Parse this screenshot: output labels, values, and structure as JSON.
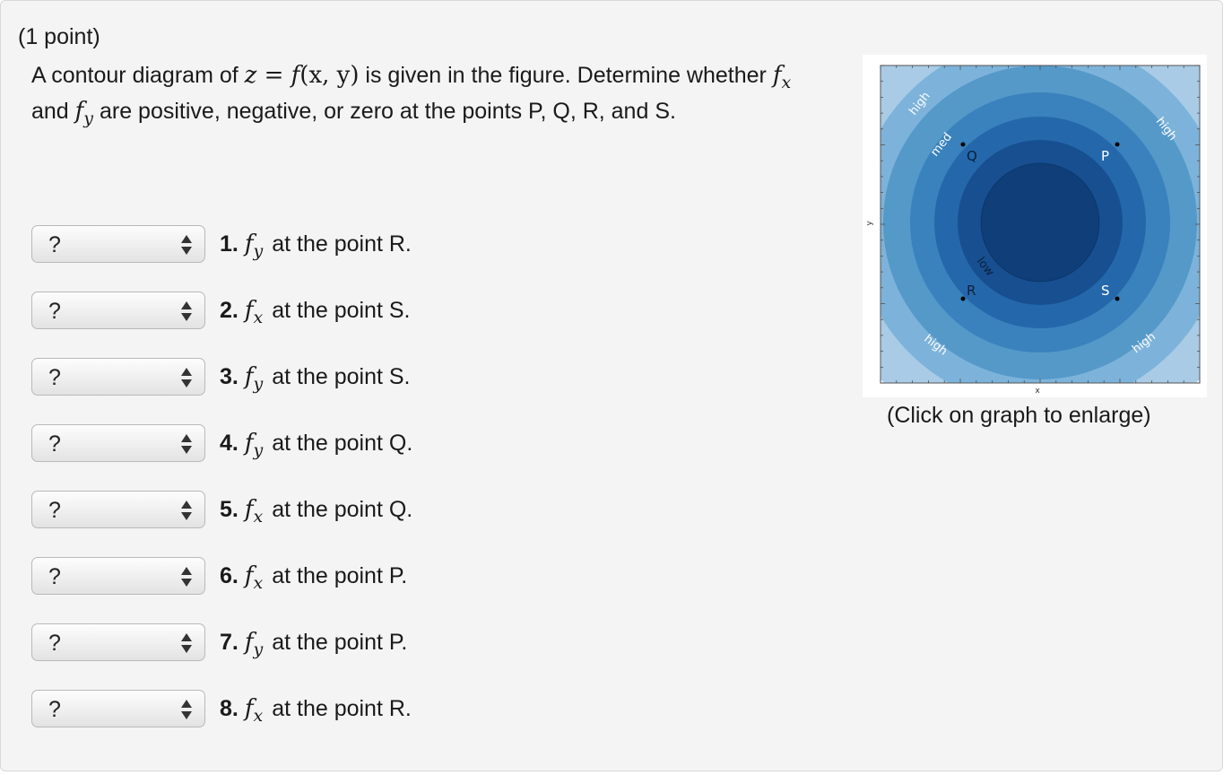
{
  "header": {
    "points": "(1 point)"
  },
  "prompt": {
    "part1": "A contour diagram of ",
    "eq_z": "z",
    "eq_eq": " = ",
    "eq_f": "f",
    "eq_args": "(x, y)",
    "part2": " is given in the figure. Determine whether ",
    "fx_f": "f",
    "fx_sub": "x",
    "part3": " and ",
    "fy_f": "f",
    "fy_sub": "y",
    "part4": " are positive, negative, or zero at the points P, Q, R, and S."
  },
  "questions": [
    {
      "select_value": "?",
      "number": "1.",
      "f": "f",
      "sub": "y",
      "text": "at the point R."
    },
    {
      "select_value": "?",
      "number": "2.",
      "f": "f",
      "sub": "x",
      "text": "at the point S."
    },
    {
      "select_value": "?",
      "number": "3.",
      "f": "f",
      "sub": "y",
      "text": "at the point S."
    },
    {
      "select_value": "?",
      "number": "4.",
      "f": "f",
      "sub": "y",
      "text": "at the point Q."
    },
    {
      "select_value": "?",
      "number": "5.",
      "f": "f",
      "sub": "x",
      "text": "at the point Q."
    },
    {
      "select_value": "?",
      "number": "6.",
      "f": "f",
      "sub": "x",
      "text": "at the point P."
    },
    {
      "select_value": "?",
      "number": "7.",
      "f": "f",
      "sub": "y",
      "text": "at the point P."
    },
    {
      "select_value": "?",
      "number": "8.",
      "f": "f",
      "sub": "x",
      "text": "at the point R."
    }
  ],
  "figure": {
    "xlabel": "x",
    "ylabel": "y",
    "labels": {
      "high": "high",
      "med": "med",
      "low": "low"
    },
    "points": {
      "P": "P",
      "Q": "Q",
      "R": "R",
      "S": "S"
    },
    "colors": [
      "#d6e5f4",
      "#a9cbe6",
      "#7db3da",
      "#5599c9",
      "#3a82bd",
      "#2468ab",
      "#174f91",
      "#0f3e78"
    ],
    "caption": "(Click on graph to enlarge)"
  }
}
